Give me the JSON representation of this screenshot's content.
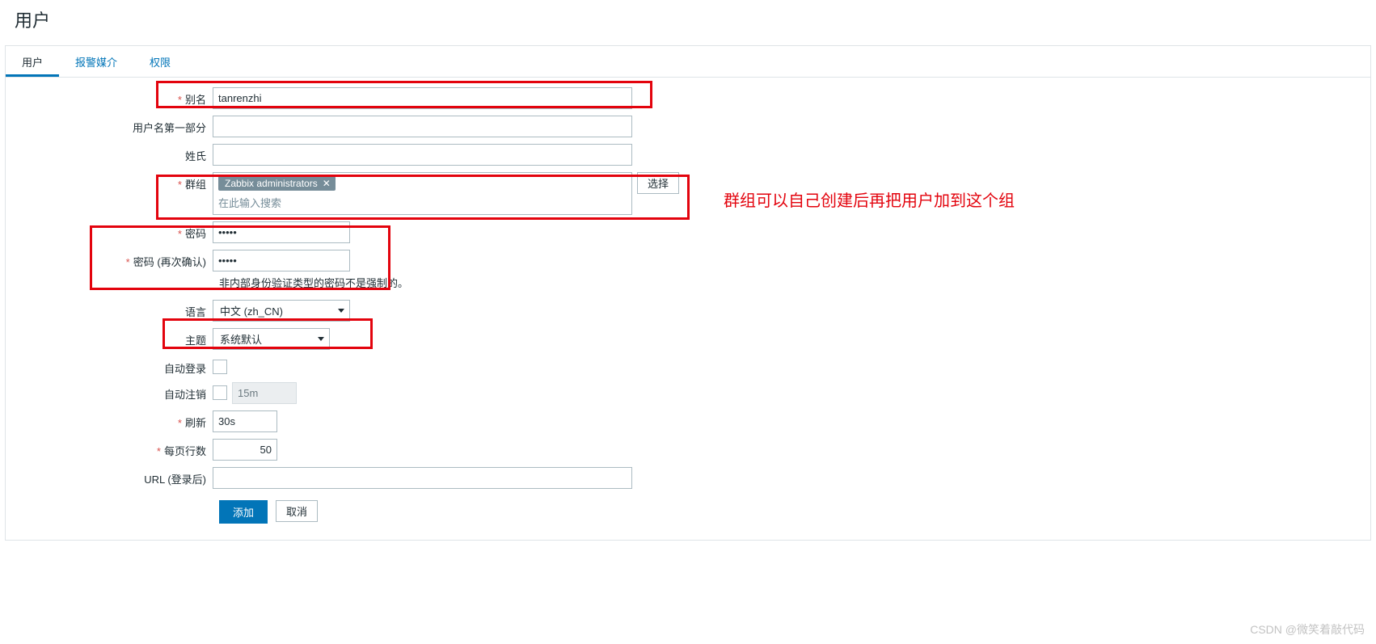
{
  "page": {
    "title": "用户"
  },
  "tabs": [
    {
      "label": "用户",
      "active": true
    },
    {
      "label": "报警媒介",
      "active": false
    },
    {
      "label": "权限",
      "active": false
    }
  ],
  "form": {
    "alias": {
      "label": "别名",
      "value": "tanrenzhi"
    },
    "name": {
      "label": "用户名第一部分",
      "value": ""
    },
    "surname": {
      "label": "姓氏",
      "value": ""
    },
    "groups": {
      "label": "群组",
      "tag": "Zabbix administrators",
      "placeholder": "在此输入搜索",
      "select_btn": "选择"
    },
    "password": {
      "label": "密码",
      "value": "•••••"
    },
    "password2": {
      "label": "密码 (再次确认)",
      "value": "•••••"
    },
    "password_hint": "非内部身份验证类型的密码不是强制的。",
    "language": {
      "label": "语言",
      "value": "中文 (zh_CN)"
    },
    "theme": {
      "label": "主题",
      "value": "系统默认"
    },
    "autologin": {
      "label": "自动登录"
    },
    "autologout": {
      "label": "自动注销",
      "value": "15m"
    },
    "refresh": {
      "label": "刷新",
      "value": "30s"
    },
    "rows": {
      "label": "每页行数",
      "value": "50"
    },
    "url": {
      "label": "URL (登录后)",
      "value": ""
    }
  },
  "buttons": {
    "add": "添加",
    "cancel": "取消"
  },
  "annotation": "群组可以自己创建后再把用户加到这个组",
  "watermark": "CSDN @微笑着敲代码"
}
